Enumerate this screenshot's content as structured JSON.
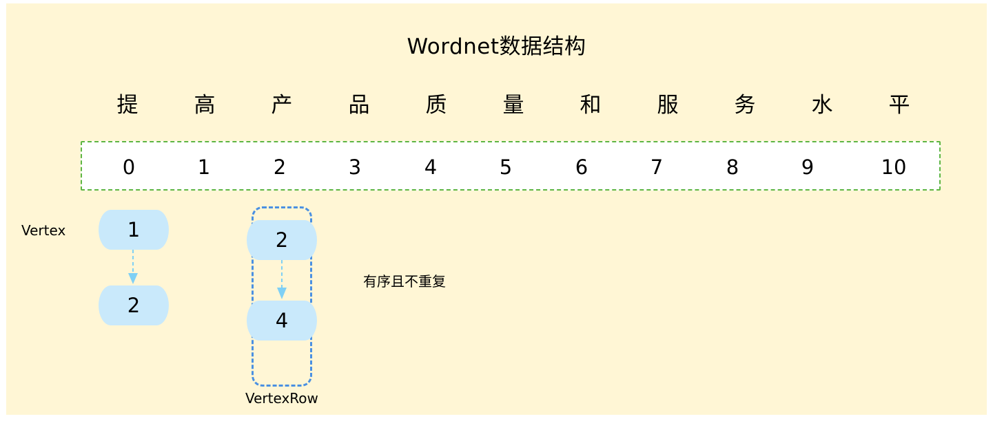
{
  "title": "Wordnet数据结构",
  "characters": [
    "提",
    "高",
    "产",
    "品",
    "质",
    "量",
    "和",
    "服",
    "务",
    "水",
    "平"
  ],
  "indices": [
    "0",
    "1",
    "2",
    "3",
    "4",
    "5",
    "6",
    "7",
    "8",
    "9",
    "10"
  ],
  "vertex": {
    "label": "Vertex",
    "nodes": [
      "1",
      "2"
    ]
  },
  "vertex_row": {
    "label": "VertexRow",
    "nodes": [
      "2",
      "4"
    ]
  },
  "note": "有序且不重复",
  "colors": {
    "background": "#fff6d5",
    "index_border": "#5db542",
    "node_fill": "#c9e9fb",
    "row_border": "#4a90e2",
    "arrow": "#7fd0f5"
  }
}
